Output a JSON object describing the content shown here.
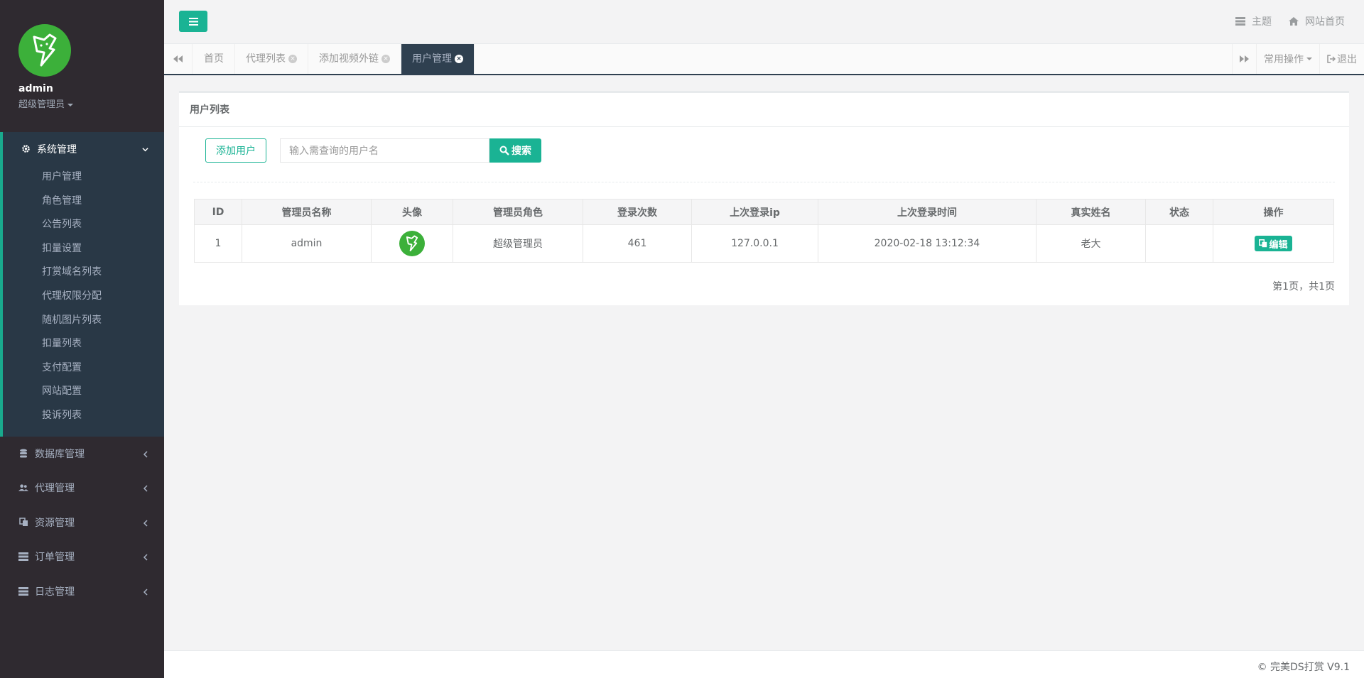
{
  "profile": {
    "name": "admin",
    "role": "超级管理员"
  },
  "sidebar": {
    "active_group": "系统管理",
    "sub_items": [
      "用户管理",
      "角色管理",
      "公告列表",
      "扣量设置",
      "打赏域名列表",
      "代理权限分配",
      "随机图片列表",
      "扣量列表",
      "支付配置",
      "网站配置",
      "投诉列表"
    ],
    "groups": [
      "数据库管理",
      "代理管理",
      "资源管理",
      "订单管理",
      "日志管理"
    ]
  },
  "header": {
    "theme": "主题",
    "home": "网站首页"
  },
  "tabs": {
    "items": [
      "首页",
      "代理列表",
      "添加视频外链",
      "用户管理"
    ],
    "common_ops": "常用操作",
    "logout": "退出"
  },
  "panel": {
    "title": "用户列表",
    "add_label": "添加用户",
    "search_placeholder": "输入需查询的用户名",
    "search_label": "搜索"
  },
  "table": {
    "headers": [
      "ID",
      "管理员名称",
      "头像",
      "管理员角色",
      "登录次数",
      "上次登录ip",
      "上次登录时间",
      "真实姓名",
      "状态",
      "操作"
    ],
    "rows": [
      {
        "id": "1",
        "name": "admin",
        "role": "超级管理员",
        "logins": "461",
        "ip": "127.0.0.1",
        "time": "2020-02-18 13:12:34",
        "real_name": "老大",
        "status": "",
        "action": "编辑"
      }
    ]
  },
  "pager": "第1页，共1页",
  "footer": "© 完美DS打赏 V9.1",
  "colors": {
    "accent": "#1ab394",
    "sidebar": "#2f2a30",
    "avatar": "#3cb03a"
  }
}
